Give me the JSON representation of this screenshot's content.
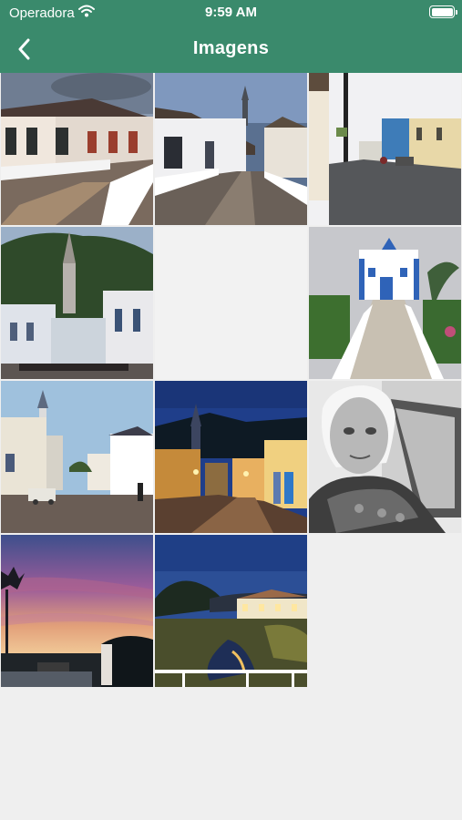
{
  "status_bar": {
    "carrier": "Operadora",
    "time": "9:59 AM",
    "wifi_icon": "wifi-icon",
    "battery_icon": "battery-icon"
  },
  "nav": {
    "title": "Imagens",
    "back_icon": "chevron-left-icon"
  },
  "colors": {
    "header": "#3a8a6c",
    "background": "#efefef"
  },
  "gallery": {
    "tiles": [
      {
        "subject": "colonial-street-white-railing"
      },
      {
        "subject": "church-tower-street"
      },
      {
        "subject": "cobblestone-street"
      },
      {
        "subject": "church-on-hill"
      },
      {
        "subject": "empty"
      },
      {
        "subject": "blue-white-church-staircase"
      },
      {
        "subject": "dusk-street-church"
      },
      {
        "subject": "night-street-church"
      },
      {
        "subject": "elderly-woman-portrait"
      },
      {
        "subject": "sunset-sky"
      },
      {
        "subject": "river-night"
      }
    ]
  }
}
